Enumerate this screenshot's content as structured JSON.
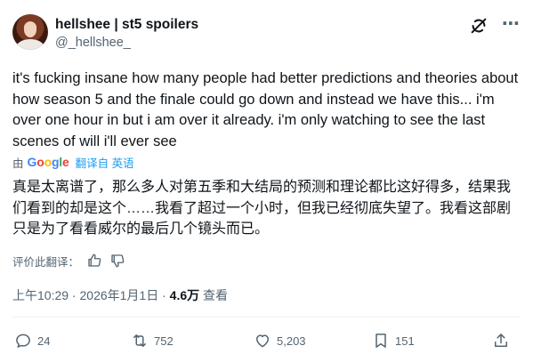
{
  "author": {
    "display_name": "hellshee | st5 spoilers",
    "handle": "@_hellshee_"
  },
  "tweet": {
    "text": "it's fucking insane how many people had better predictions and theories about how season 5 and the finale could go down and instead we have this... i'm over one hour in but i am over it already. i'm only watching to see the last scenes of will i'll ever see"
  },
  "translation": {
    "by_label": "由",
    "provider": "Google",
    "from_label": "翻译自 英语",
    "text": "真是太离谱了，那么多人对第五季和大结局的预测和理论都比这好得多，结果我们看到的却是这个……我看了超过一个小时，但我已经彻底失望了。我看这部剧只是为了看看威尔的最后几个镜头而已。",
    "feedback_label": "评价此翻译："
  },
  "meta": {
    "time": "上午10:29",
    "separator": " · ",
    "date": "2026年1月1日",
    "separator2": " · ",
    "views_count": "4.6万",
    "views_label": " 查看"
  },
  "actions": {
    "replies": "24",
    "reposts": "752",
    "likes": "5,203",
    "bookmarks": "151"
  },
  "icons": [
    "grok-icon",
    "more-icon",
    "thumbs-up-icon",
    "thumbs-down-icon",
    "reply-icon",
    "repost-icon",
    "like-icon",
    "bookmark-icon",
    "share-icon"
  ]
}
